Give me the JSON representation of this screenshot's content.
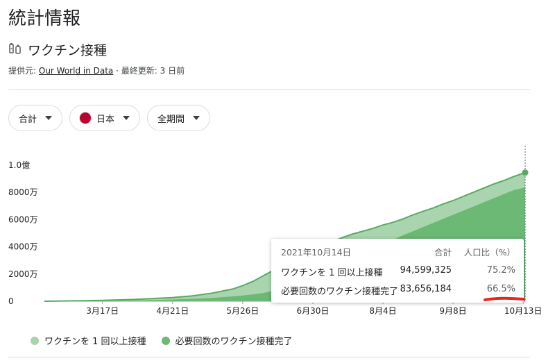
{
  "page": {
    "title": "統計情報"
  },
  "section": {
    "title": "ワクチン接種",
    "icon": "vaccine-icon"
  },
  "source": {
    "prefix": "提供元:",
    "name": "Our World in Data",
    "separator": "·",
    "updated": "最終更新: 3 日前"
  },
  "filters": [
    {
      "label": "合計"
    },
    {
      "label": "日本",
      "flag": "japan-flag"
    },
    {
      "label": "全期間"
    }
  ],
  "tooltip": {
    "date": "2021年10月14日",
    "col_total": "合計",
    "col_pct": "人口比（%）",
    "rows": [
      {
        "label": "ワクチンを 1 回以上接種",
        "total": "94,599,325",
        "pct": "75.2%"
      },
      {
        "label": "必要回数のワクチン接種完了",
        "total": "83,656,184",
        "pct": "66.5%"
      }
    ]
  },
  "colors": {
    "light_series": "#a8d5ad",
    "dark_series": "#6cb875",
    "line": "#5aaa63",
    "annotation": "#e8261c"
  },
  "chart_data": {
    "type": "area",
    "ylabel_ticks": [
      "0",
      "2000万",
      "4000万",
      "6000万",
      "8000万",
      "1.0億"
    ],
    "y_ticks": [
      0,
      20000000,
      40000000,
      60000000,
      80000000,
      100000000
    ],
    "ylim": [
      0,
      100000000
    ],
    "x_tick_labels": [
      "3月17日",
      "4月21日",
      "5月26日",
      "6月30日",
      "8月4日",
      "9月8日",
      "10月13日"
    ],
    "x_tick_days": [
      75,
      110,
      145,
      180,
      215,
      250,
      285
    ],
    "x_range_days": [
      46,
      286
    ],
    "series": [
      {
        "name": "ワクチンを 1 回以上接種",
        "x_days": [
          46,
          75,
          90,
          100,
          110,
          120,
          130,
          140,
          145,
          150,
          155,
          160,
          165,
          170,
          175,
          180,
          185,
          190,
          195,
          200,
          205,
          210,
          215,
          220,
          225,
          230,
          235,
          240,
          245,
          250,
          255,
          260,
          265,
          270,
          275,
          280,
          286
        ],
        "values": [
          0,
          600000,
          1300000,
          2000000,
          2700000,
          4000000,
          6000000,
          9000000,
          11500000,
          14500000,
          18500000,
          22500000,
          27000000,
          31000000,
          35000000,
          38500000,
          41500000,
          44000000,
          47000000,
          49500000,
          51500000,
          53500000,
          56000000,
          58000000,
          60500000,
          63500000,
          66000000,
          68500000,
          71500000,
          74000000,
          77000000,
          80000000,
          83000000,
          86000000,
          88500000,
          91500000,
          94599325
        ]
      },
      {
        "name": "必要回数のワクチン接種完了",
        "x_days": [
          46,
          75,
          90,
          100,
          110,
          120,
          130,
          140,
          145,
          150,
          155,
          160,
          165,
          170,
          175,
          180,
          185,
          190,
          195,
          200,
          205,
          210,
          215,
          220,
          225,
          230,
          235,
          240,
          245,
          250,
          255,
          260,
          265,
          270,
          275,
          280,
          286
        ],
        "values": [
          0,
          200000,
          500000,
          800000,
          1200000,
          1800000,
          2500000,
          3500000,
          4200000,
          5000000,
          6000000,
          7500000,
          9500000,
          12000000,
          14500000,
          17500000,
          21000000,
          24500000,
          28000000,
          32000000,
          35000000,
          38000000,
          41500000,
          45000000,
          48500000,
          51500000,
          54500000,
          57500000,
          60500000,
          63500000,
          66500000,
          69500000,
          72500000,
          75500000,
          78500000,
          81500000,
          83656184
        ]
      }
    ],
    "legend": [
      "ワクチンを 1 回以上接種",
      "必要回数のワクチン接種完了"
    ]
  }
}
